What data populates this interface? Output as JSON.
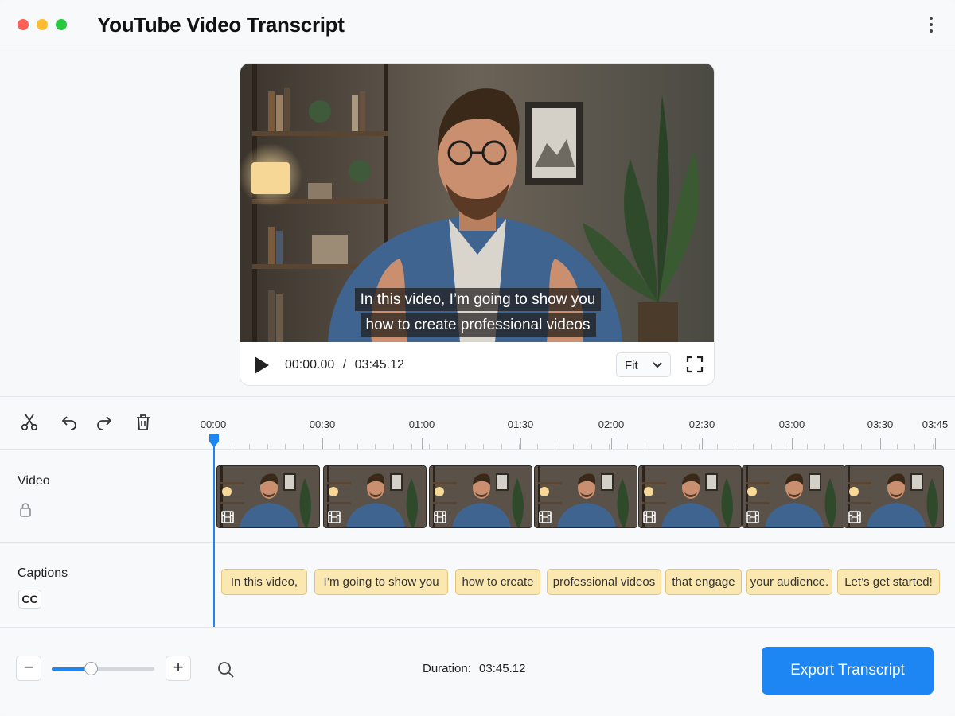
{
  "window": {
    "title": "YouTube Video Transcript"
  },
  "player": {
    "caption_lines": [
      "In this video, I’m going to show you",
      "how to create professional videos"
    ],
    "current_time": "00:00.00",
    "separator": "/",
    "total_time": "03:45.12",
    "fit_option": "Fit"
  },
  "timeline": {
    "ruler_labels": [
      "00:00",
      "00:30",
      "01:00",
      "01:30",
      "02:00",
      "02:30",
      "03:00",
      "03:30",
      "03:45"
    ],
    "tracks": {
      "video_label": "Video",
      "captions_label": "Captions",
      "cc_badge": "CC"
    },
    "caption_chips": [
      "In this video,",
      "I’m going to show you",
      "how to create",
      "professional videos",
      "that engage",
      "your audience.",
      "Let’s get started!"
    ],
    "video_clip_count": 7
  },
  "footer": {
    "zoom_minus": "−",
    "zoom_plus": "+",
    "zoom_level": 0.38,
    "duration_label": "Duration:",
    "duration_value": "03:45.12",
    "export_label": "Export Transcript"
  },
  "colors": {
    "accent": "#1e86f2",
    "caption_chip": "#fae8b0",
    "traffic_red": "#ff5f57",
    "traffic_yellow": "#febc2e",
    "traffic_green": "#28c840"
  },
  "icons": [
    "scissors-icon",
    "undo-icon",
    "redo-icon",
    "trash-icon",
    "play-icon",
    "fullscreen-icon",
    "chevron-down-icon",
    "lock-icon",
    "film-icon",
    "search-icon",
    "kebab-menu-icon"
  ]
}
